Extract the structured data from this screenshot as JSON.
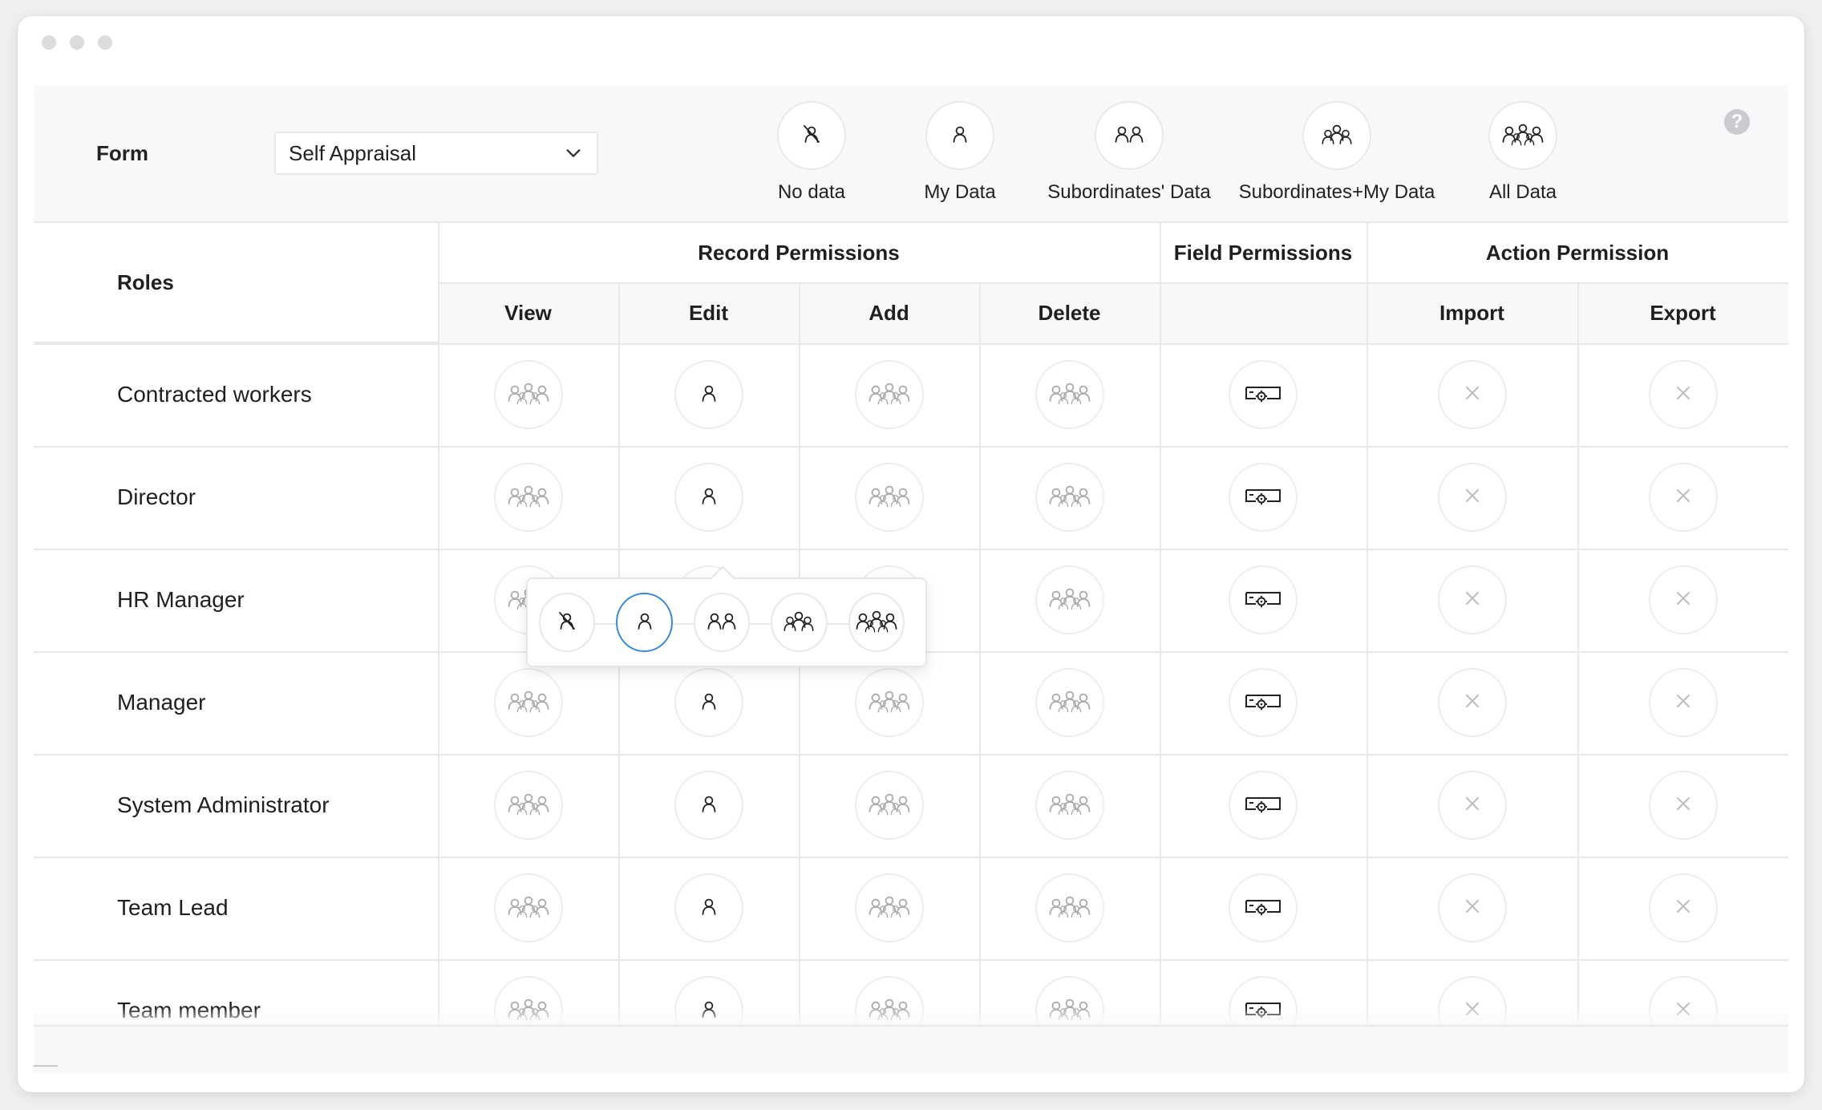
{
  "toolbar": {
    "form_label": "Form",
    "form_value": "Self Appraisal",
    "help_label": "?",
    "legend": [
      {
        "label": "No data",
        "icon": "no-data-icon"
      },
      {
        "label": "My Data",
        "icon": "my-data-icon"
      },
      {
        "label": "Subordinates' Data",
        "icon": "subordinates-data-icon"
      },
      {
        "label": "Subordinates+My Data",
        "icon": "subordinates-my-data-icon"
      },
      {
        "label": "All Data",
        "icon": "all-data-icon"
      }
    ]
  },
  "table": {
    "roles_header": "Roles",
    "groups": {
      "record": "Record Permissions",
      "field": "Field Permissions",
      "action": "Action Permission"
    },
    "columns": {
      "view": "View",
      "edit": "Edit",
      "add": "Add",
      "delete": "Delete",
      "import": "Import",
      "export": "Export"
    },
    "rows": [
      {
        "role": "Contracted workers"
      },
      {
        "role": "Director"
      },
      {
        "role": "HR Manager"
      },
      {
        "role": "Manager"
      },
      {
        "role": "System Administrator"
      },
      {
        "role": "Team Lead"
      },
      {
        "role": "Team member"
      }
    ],
    "cell_icons": {
      "view": "all-data-icon",
      "edit": "my-data-icon",
      "add": "all-data-icon",
      "delete": "all-data-icon",
      "field": "field-settings-icon",
      "import": "close-icon",
      "export": "close-icon"
    }
  },
  "popover": {
    "options": [
      "no-data-icon",
      "my-data-icon",
      "subordinates-data-icon",
      "subordinates-my-data-icon",
      "all-data-icon"
    ],
    "selected": "my-data-icon"
  },
  "colors": {
    "accent": "#3b86d6",
    "header_bg": "#f7f8f9",
    "border": "#e6e8ea"
  }
}
